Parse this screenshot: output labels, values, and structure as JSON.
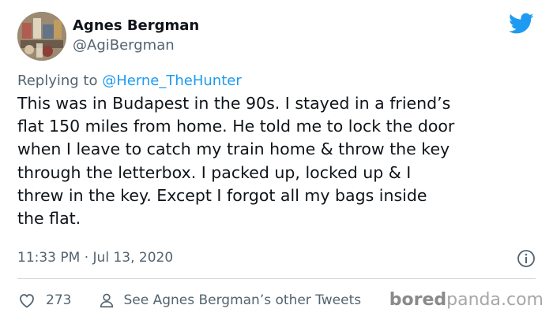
{
  "tweet": {
    "author_name": "Agnes Bergman",
    "author_handle": "@AgiBergman",
    "reply_prefix": "Replying to ",
    "reply_to": "@Herne_TheHunter",
    "text": "This was in Budapest in the 90s. I stayed in a friend’s\nflat 150 miles from home. He told me to lock the door\nwhen I leave to catch my train home & throw the key\nthrough the letterbox. I packed up, locked up & I\nthrew in the key. Except I forgot all my bags inside\nthe flat.",
    "timestamp": "11:33 PM · Jul 13, 2020",
    "like_count": "273",
    "other_tweets_label": "See Agnes Bergman’s other Tweets"
  },
  "icons": {
    "brand": "twitter-bird-icon",
    "info": "info-icon",
    "like": "heart-icon",
    "profile": "person-icon"
  },
  "colors": {
    "brand_blue": "#1d9bf0",
    "text": "#0f1419",
    "muted": "#536471",
    "divider": "#cfd9de"
  },
  "watermark": {
    "bold": "bored",
    "rest": "panda.com"
  }
}
